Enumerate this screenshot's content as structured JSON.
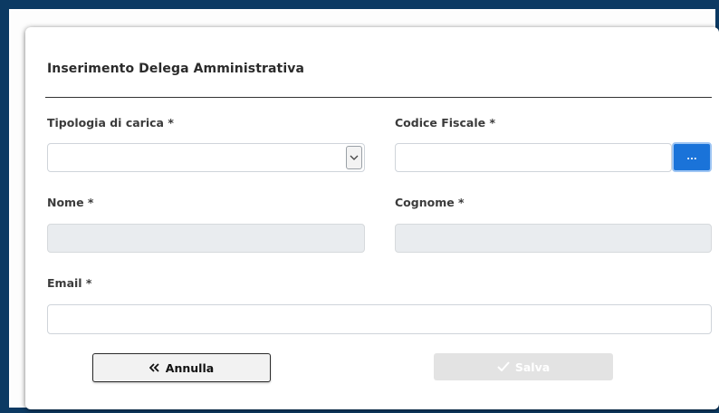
{
  "dialog": {
    "title": "Inserimento Delega Amministrativa"
  },
  "form": {
    "tipologia": {
      "label": "Tipologia di carica *",
      "value": ""
    },
    "codice_fiscale": {
      "label": "Codice Fiscale *",
      "value": "",
      "lookup_label": "..."
    },
    "nome": {
      "label": "Nome *",
      "value": ""
    },
    "cognome": {
      "label": "Cognome *",
      "value": ""
    },
    "email": {
      "label": "Email *",
      "value": ""
    }
  },
  "actions": {
    "annulla_label": "Annulla",
    "annulla_icon": "double-chevron-left-icon",
    "salva_label": "Salva",
    "salva_icon": "check-icon",
    "salva_enabled": false
  },
  "colors": {
    "frame": "#0c3a63",
    "primary": "#1a73d9",
    "disabled_bg": "#e9ecef"
  }
}
